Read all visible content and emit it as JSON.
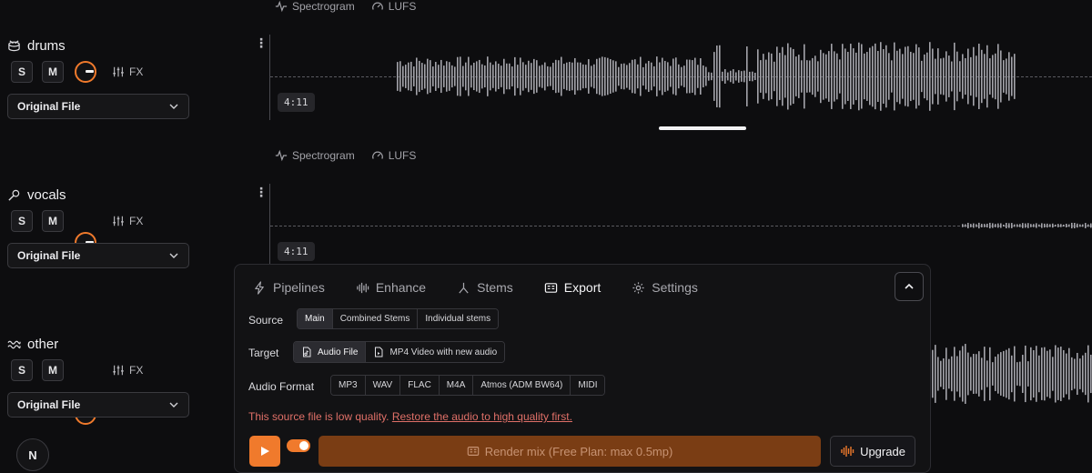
{
  "tracks": [
    {
      "name": "drums",
      "icon": "drum-icon",
      "solo": "S",
      "mute": "M",
      "fx": "FX",
      "source": "Original File",
      "time": "4:11",
      "tools": {
        "spectrogram": "Spectrogram",
        "lufs": "LUFS"
      }
    },
    {
      "name": "vocals",
      "icon": "microphone-icon",
      "solo": "S",
      "mute": "M",
      "fx": "FX",
      "source": "Original File",
      "time": "4:11",
      "tools": {
        "spectrogram": "Spectrogram",
        "lufs": "LUFS"
      }
    },
    {
      "name": "other",
      "icon": "wave-icon",
      "solo": "S",
      "mute": "M",
      "fx": "FX",
      "source": "Original File"
    }
  ],
  "avatar_letter": "N",
  "panel": {
    "tabs": [
      {
        "label": "Pipelines",
        "icon": "bolt-icon"
      },
      {
        "label": "Enhance",
        "icon": "waveform-icon"
      },
      {
        "label": "Stems",
        "icon": "branch-icon"
      },
      {
        "label": "Export",
        "icon": "export-icon",
        "active": true
      },
      {
        "label": "Settings",
        "icon": "gear-icon"
      }
    ],
    "source": {
      "label": "Source",
      "options": [
        "Main",
        "Combined Stems",
        "Individual stems"
      ],
      "selected": "Main"
    },
    "target": {
      "label": "Target",
      "options": [
        "Audio File",
        "MP4 Video with new audio"
      ],
      "selected": "Audio File"
    },
    "audio_format": {
      "label": "Audio Format",
      "options": [
        "MP3",
        "WAV",
        "FLAC",
        "M4A",
        "Atmos (ADM BW64)",
        "MIDI"
      ]
    },
    "warning": {
      "text": "This source file is low quality.",
      "link": "Restore the audio to high quality first."
    },
    "render_label": "Render mix (Free Plan: max 0.5mp)",
    "upgrade_label": "Upgrade"
  },
  "colors": {
    "accent": "#f07a2c",
    "background": "#0d0d0f",
    "waveform": "#a4a4ab",
    "warning": "#e07068"
  }
}
